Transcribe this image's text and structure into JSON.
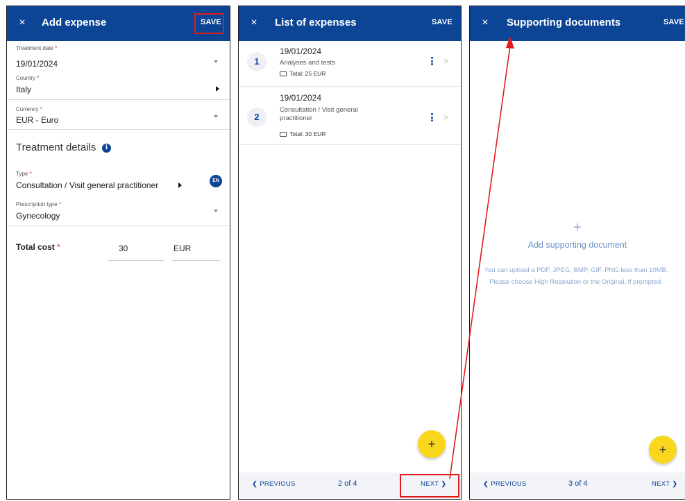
{
  "add_expense": {
    "title": "Add expense",
    "close_symbol": "×",
    "save_label": "SAVE",
    "treatment_date": {
      "label": "Treatment date",
      "required": "*",
      "value": "19/01/2024"
    },
    "country": {
      "label": "Country",
      "required": "*",
      "value": "Italy"
    },
    "currency": {
      "label": "Currency",
      "required": "*",
      "value": "EUR - Euro"
    },
    "section_title": "Treatment details",
    "info_glyph": "i",
    "type": {
      "label": "Type",
      "required": "*",
      "value": "Consultation / Visit general practitioner",
      "lang_badge": "EN"
    },
    "prescription_type": {
      "label": "Prescription type",
      "required": "*",
      "value": "Gynecology"
    },
    "total_cost": {
      "label": "Total cost",
      "required": "*",
      "amount": "30",
      "currency": "EUR"
    }
  },
  "list_of_expenses": {
    "title": "List of expenses",
    "close_symbol": "×",
    "save_label": "SAVE",
    "items": [
      {
        "number": "1",
        "date": "19/01/2024",
        "description": "Analyses and tests",
        "total": "Total: 25 EUR"
      },
      {
        "number": "2",
        "date": "19/01/2024",
        "description": "Consultation / Visit general practitioner",
        "total": "Total: 30 EUR"
      }
    ],
    "fab_symbol": "+",
    "footer": {
      "previous": "❮ PREVIOUS",
      "page": "2 of 4",
      "next": "NEXT ❯"
    }
  },
  "supporting_documents": {
    "title": "Supporting documents",
    "close_symbol": "×",
    "save_label": "SAVE",
    "add_symbol": "+",
    "add_label": "Add supporting document",
    "upload_line1": "You can upload a PDF, JPEG, BMP, GIF, PNG less than 10MB.",
    "upload_line2": "Please choose High Resolution or the Original, if prompted.",
    "fab_symbol": "+",
    "footer": {
      "previous": "❮ PREVIOUS",
      "page": "3 of 4",
      "next": "NEXT ❯"
    }
  },
  "colors": {
    "header_blue": "#0c4496",
    "highlight_red": "#e01b1b",
    "fab_yellow": "#f9d71c"
  },
  "icons": {
    "close": "close-icon",
    "dropdown": "chevron-down-icon",
    "submenu": "triangle-right-icon",
    "info": "info-icon",
    "kebab": "more-vertical-icon",
    "chevron": "chevron-right-icon",
    "wallet": "wallet-icon",
    "add": "plus-icon"
  }
}
